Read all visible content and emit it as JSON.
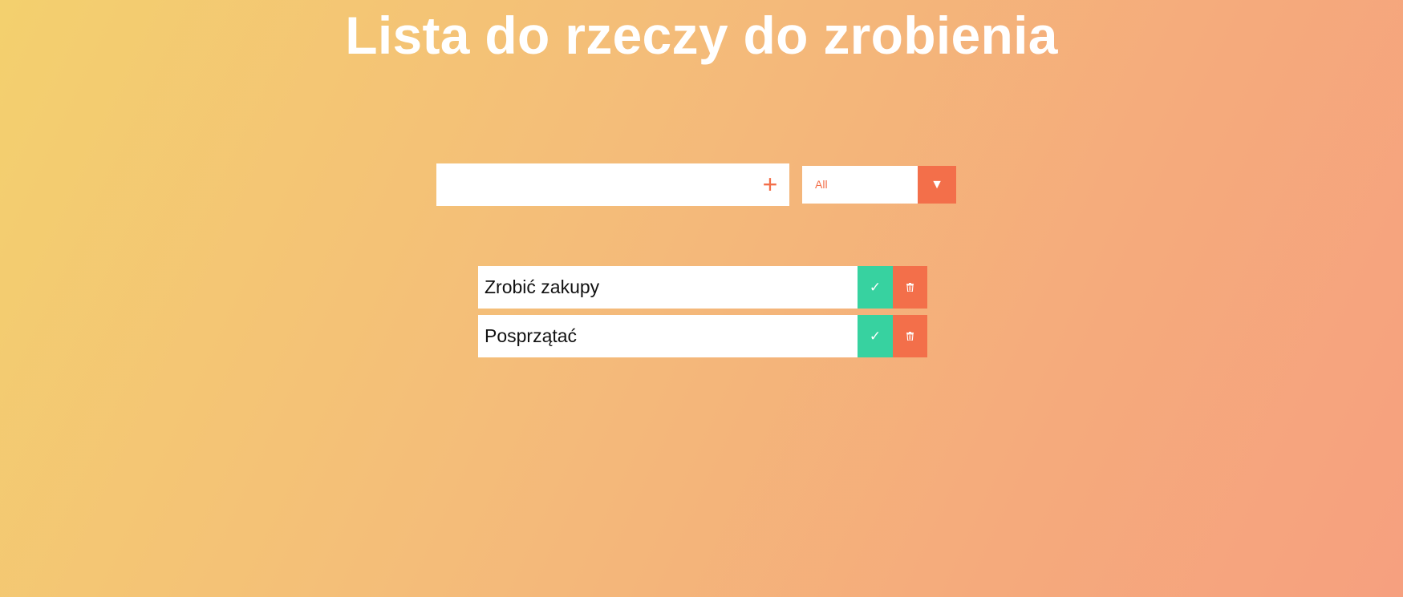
{
  "header": {
    "title": "Lista do rzeczy do zrobienia"
  },
  "form": {
    "input_value": "",
    "add_icon": "plus-icon",
    "add_symbol": "+"
  },
  "filter": {
    "selected": "All",
    "arrow_icon": "triangle-down-icon",
    "arrow_symbol": "▼"
  },
  "todos": [
    {
      "text": "Zrobić zakupy",
      "complete_icon": "checkmark-icon",
      "complete_symbol": "✓",
      "delete_icon": "trash-icon"
    },
    {
      "text": "Posprzątać",
      "complete_icon": "checkmark-icon",
      "complete_symbol": "✓",
      "delete_icon": "trash-icon"
    }
  ],
  "colors": {
    "accent": "#f36f4a",
    "complete": "#37d2a0",
    "background_start": "#f3d06e",
    "background_end": "#f6a07f"
  }
}
